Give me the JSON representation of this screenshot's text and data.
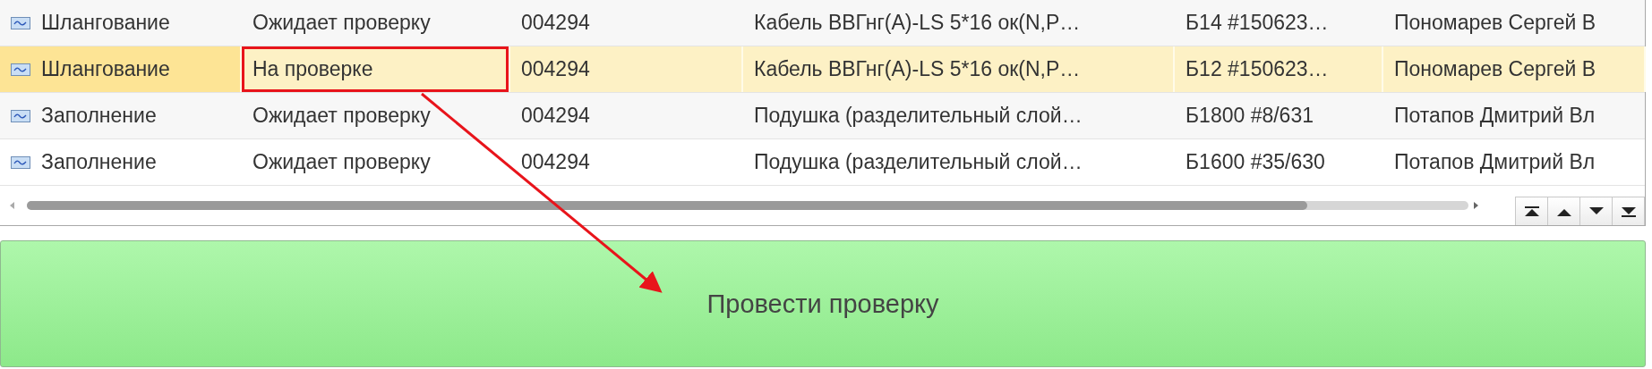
{
  "table": {
    "rows": [
      {
        "selected": false,
        "cells": [
          {
            "text": "Шлангование",
            "highlighted": false
          },
          {
            "text": "Ожидает проверку",
            "highlighted": false
          },
          {
            "text": "004294",
            "highlighted": false
          },
          {
            "text": "Кабель ВВГнг(А)-LS 5*16 ок(N,P…",
            "highlighted": false
          },
          {
            "text": "Б14 #150623…",
            "highlighted": false
          },
          {
            "text": "Пономарев Сергей В",
            "highlighted": false
          }
        ]
      },
      {
        "selected": true,
        "cells": [
          {
            "text": "Шлангование",
            "highlighted": false
          },
          {
            "text": "На проверке",
            "highlighted": true
          },
          {
            "text": "004294",
            "highlighted": false
          },
          {
            "text": "Кабель ВВГнг(А)-LS 5*16 ок(N,P…",
            "highlighted": false
          },
          {
            "text": "Б12 #150623…",
            "highlighted": false
          },
          {
            "text": "Пономарев Сергей В",
            "highlighted": false
          }
        ]
      },
      {
        "selected": false,
        "cells": [
          {
            "text": "Заполнение",
            "highlighted": false
          },
          {
            "text": "Ожидает проверку",
            "highlighted": false
          },
          {
            "text": "004294",
            "highlighted": false
          },
          {
            "text": "Подушка (разделительный слой…",
            "highlighted": false
          },
          {
            "text": "Б1800 #8/631",
            "highlighted": false
          },
          {
            "text": "Потапов Дмитрий Вл",
            "highlighted": false
          }
        ]
      },
      {
        "selected": false,
        "cells": [
          {
            "text": "Заполнение",
            "highlighted": false
          },
          {
            "text": "Ожидает проверку",
            "highlighted": false
          },
          {
            "text": "004294",
            "highlighted": false
          },
          {
            "text": "Подушка (разделительный слой…",
            "highlighted": false
          },
          {
            "text": "Б1600 #35/630",
            "highlighted": false
          },
          {
            "text": "Потапов Дмитрий Вл",
            "highlighted": false
          }
        ]
      }
    ]
  },
  "action_button": {
    "label": "Провести проверку"
  }
}
